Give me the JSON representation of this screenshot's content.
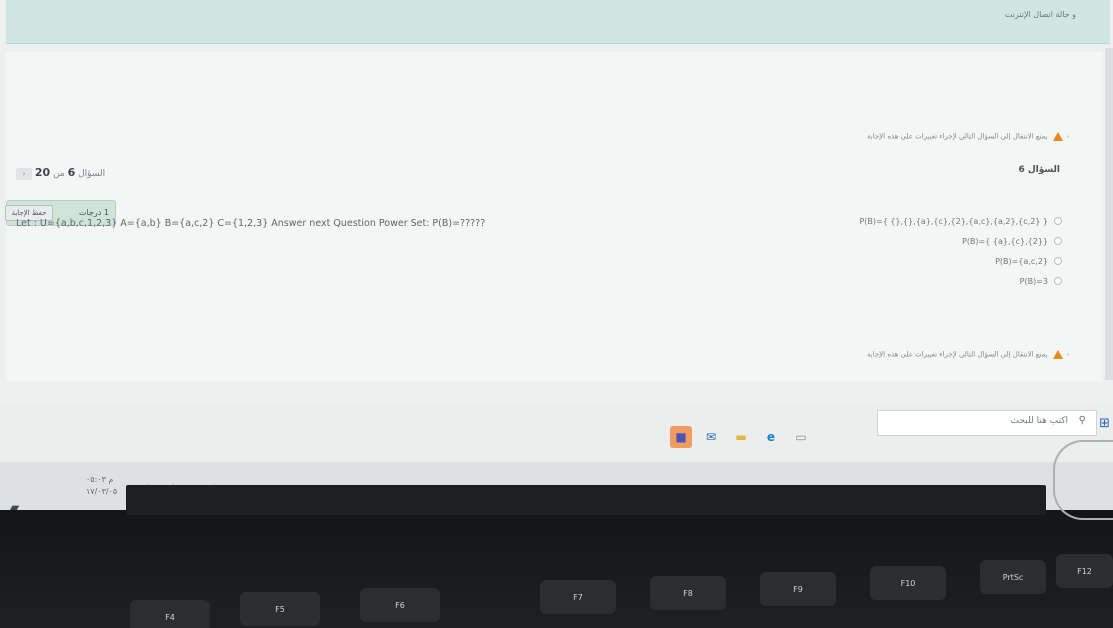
{
  "banner": {
    "text": "و حالة اتصال الإنترنت"
  },
  "warning": {
    "text": "يمنع الانتقال إلى السؤال التالي لإجراء تغييرات على هذه الإجابة"
  },
  "question": {
    "heading": "السؤال 6",
    "pager_label": "السؤال",
    "pager_current": "6",
    "pager_sep": "من",
    "pager_total": "20",
    "marks": "1 درجات",
    "save_label": "حفظ الإجابة",
    "text": "Let : U={a,b,c,1,2,3} A={a,b} B={a,c,2} C={1,2,3} Answer next Question Power Set: P(B)=?????",
    "options": [
      "P(B)={ {},{},{a},{c},{2},{a,c},{a,2},{c,2} }",
      "P(B)={ {a},{c},{2}}",
      "P(B)={a,c,2}",
      "P(B)=3"
    ]
  },
  "taskbar": {
    "search_placeholder": "اكتب هنا للبحث",
    "clock_time": "م ٠٥:٠٣",
    "clock_date": "١٧/٠٣/٠٥"
  },
  "keyboard": {
    "keys": [
      "F4",
      "F5",
      "F6",
      "F7",
      "F8",
      "F9",
      "F10",
      "PrtSc",
      "F12"
    ]
  }
}
